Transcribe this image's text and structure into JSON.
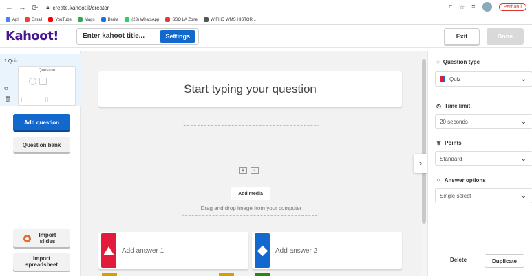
{
  "browser": {
    "url": "create.kahoot.it/creator",
    "bookmarks": [
      "Apl",
      "Gmail",
      "YouTube",
      "Maps",
      "Berita",
      "(23) WhatsApp",
      "SSO LA Zone",
      "WIFI.ID WMS HISTOR..."
    ],
    "update_label": "Perbarui"
  },
  "header": {
    "logo": "Kahoot",
    "logo_bang": "!",
    "title_placeholder": "Enter kahoot title...",
    "settings_label": "Settings",
    "exit_label": "Exit",
    "done_label": "Done"
  },
  "sidebar": {
    "slide_label": "1  Quiz",
    "thumb_label": "Question",
    "add_question_label": "Add question",
    "question_bank_label": "Question bank",
    "import_slides_label": "Import slides",
    "import_spreadsheet_label": "Import spreadsheet"
  },
  "canvas": {
    "question_placeholder": "Start typing your question",
    "add_media_label": "Add media",
    "drag_text": "Drag and drop image from your computer",
    "answers": [
      {
        "label": "Add answer 1",
        "color": "#e21b3c"
      },
      {
        "label": "Add answer 2",
        "color": "#1368ce"
      }
    ]
  },
  "panel": {
    "question_type_label": "Question type",
    "question_type_value": "Quiz",
    "time_limit_label": "Time limit",
    "time_limit_value": "20 seconds",
    "points_label": "Points",
    "points_value": "Standard",
    "answer_options_label": "Answer options",
    "answer_options_value": "Single select",
    "delete_label": "Delete",
    "duplicate_label": "Duplicate"
  }
}
